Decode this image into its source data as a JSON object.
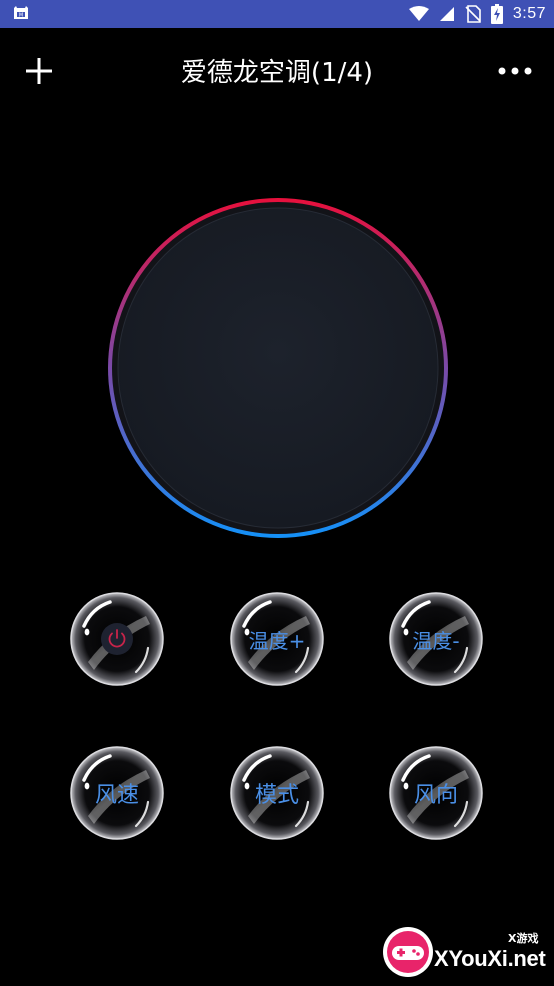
{
  "status_bar": {
    "time": "3:57",
    "app_icon": "android-notification-icon",
    "icons": [
      "wifi-icon",
      "signal-icon",
      "no-sim-icon",
      "battery-charging-icon"
    ],
    "background_color": "#3f51b5"
  },
  "toolbar": {
    "title": "爱德龙空调(1/4)",
    "add_icon": "plus-icon",
    "more_icon": "more-horizontal-icon"
  },
  "dial": {
    "ring_gradient": [
      "#e0103f",
      "#7a4aa8",
      "#1a8df5"
    ],
    "face_color": "#1a1f28"
  },
  "buttons": [
    {
      "id": "power",
      "label": "",
      "icon": "power-icon"
    },
    {
      "id": "temp-up",
      "label": "温度+"
    },
    {
      "id": "temp-down",
      "label": "温度-"
    },
    {
      "id": "fan-speed",
      "label": "风速"
    },
    {
      "id": "mode",
      "label": "模式"
    },
    {
      "id": "fan-direction",
      "label": "风向"
    }
  ],
  "accent": {
    "button_text": "#4a8fe6",
    "power_icon": "#c8244a"
  },
  "watermark": {
    "small_text": "X游戏",
    "main_text": "XYouXi.net"
  }
}
